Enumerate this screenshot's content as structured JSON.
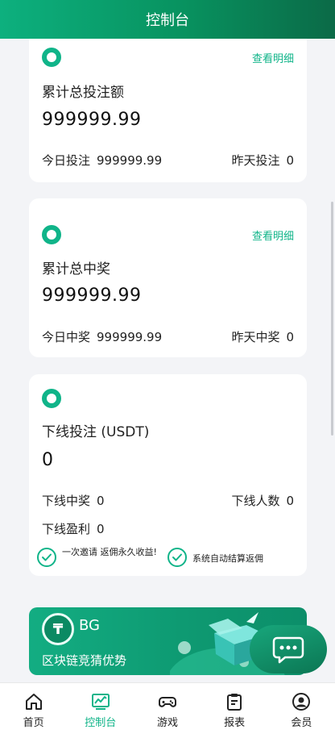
{
  "header": {
    "title": "控制台"
  },
  "cards": [
    {
      "link": "查看明细",
      "label": "累计总投注额",
      "total": "999999.99",
      "today_label": "今日投注",
      "today_value": "999999.99",
      "yesterday_label": "昨天投注",
      "yesterday_value": "0"
    },
    {
      "link": "查看明细",
      "label": "累计总中奖",
      "total": "999999.99",
      "today_label": "今日中奖",
      "today_value": "999999.99",
      "yesterday_label": "昨天中奖",
      "yesterday_value": "0"
    }
  ],
  "downline": {
    "label": "下线投注 (USDT)",
    "total": "0",
    "win_label": "下线中奖",
    "win_value": "0",
    "count_label": "下线人数",
    "count_value": "0",
    "profit_label": "下线盈利",
    "profit_value": "0",
    "note1": "一次邀请 返佣永久收益!",
    "note2": "系统自动结算返佣"
  },
  "banner": {
    "brand": "BG",
    "slogan": "区块链竞猜优势",
    "coin_glyph": "₸"
  },
  "tabs": [
    {
      "label": "首页",
      "icon": "home-icon",
      "active": false
    },
    {
      "label": "控制台",
      "icon": "dashboard-icon",
      "active": true
    },
    {
      "label": "游戏",
      "icon": "gamepad-icon",
      "active": false
    },
    {
      "label": "报表",
      "icon": "report-icon",
      "active": false
    },
    {
      "label": "会员",
      "icon": "member-icon",
      "active": false
    }
  ],
  "colors": {
    "accent": "#10b489",
    "header_start": "#0db07e",
    "header_end": "#0b6a47",
    "background": "#f3f4f7"
  }
}
